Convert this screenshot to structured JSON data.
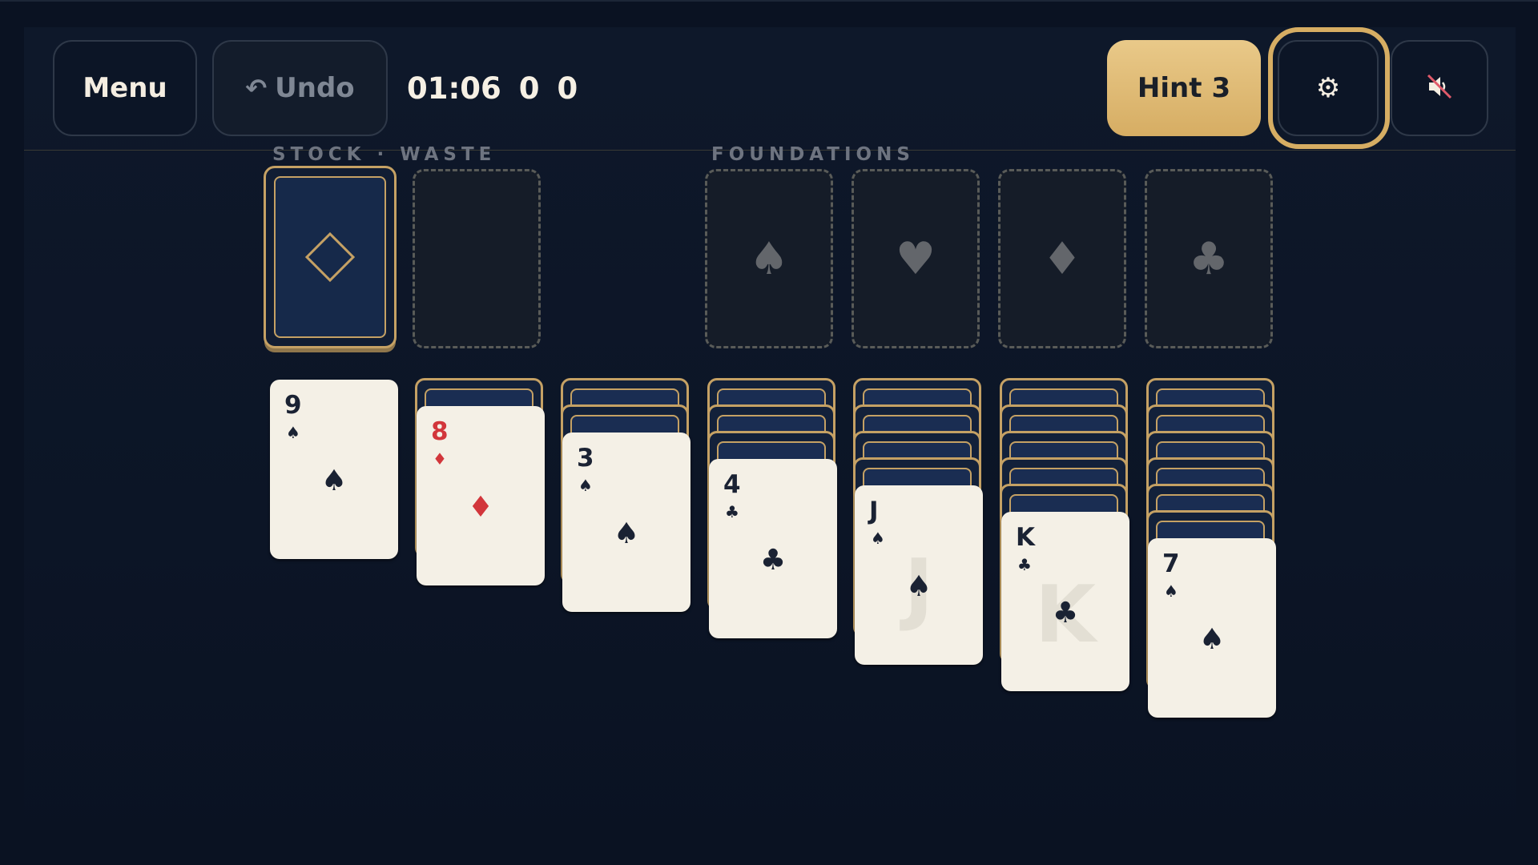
{
  "toolbar": {
    "menu_label": "Menu",
    "undo_icon": "↶",
    "undo_label": "Undo",
    "timer": "01:06",
    "moves": "0",
    "score": "0",
    "hint_label": "Hint",
    "hint_count": "3",
    "settings_icon": "⚙",
    "sound_icon": "speaker-muted-icon"
  },
  "labels": {
    "stock_waste": "STOCK · WASTE",
    "foundations": "FOUNDATIONS"
  },
  "foundations": [
    {
      "suit": "spade",
      "glyph": "♠"
    },
    {
      "suit": "heart",
      "glyph": "♥"
    },
    {
      "suit": "diamond",
      "glyph": "♦"
    },
    {
      "suit": "club",
      "glyph": "♣"
    }
  ],
  "tableau": [
    {
      "face_down": 0,
      "card": {
        "rank": "9",
        "suit": "♠",
        "color": "black"
      }
    },
    {
      "face_down": 1,
      "card": {
        "rank": "8",
        "suit": "♦",
        "color": "red"
      }
    },
    {
      "face_down": 2,
      "card": {
        "rank": "3",
        "suit": "♠",
        "color": "black"
      }
    },
    {
      "face_down": 3,
      "card": {
        "rank": "4",
        "suit": "♣",
        "color": "black"
      }
    },
    {
      "face_down": 4,
      "card": {
        "rank": "J",
        "suit": "♠",
        "color": "black",
        "face": "J"
      }
    },
    {
      "face_down": 5,
      "card": {
        "rank": "K",
        "suit": "♣",
        "color": "black",
        "face": "K"
      }
    },
    {
      "face_down": 6,
      "card": {
        "rank": "7",
        "suit": "♠",
        "color": "black"
      }
    }
  ],
  "colors": {
    "background": "#0a1222",
    "accent_gold": "#d6ad63",
    "card_face": "#f4f0e6",
    "red_suit": "#d2363b",
    "black_suit": "#1a2233"
  }
}
